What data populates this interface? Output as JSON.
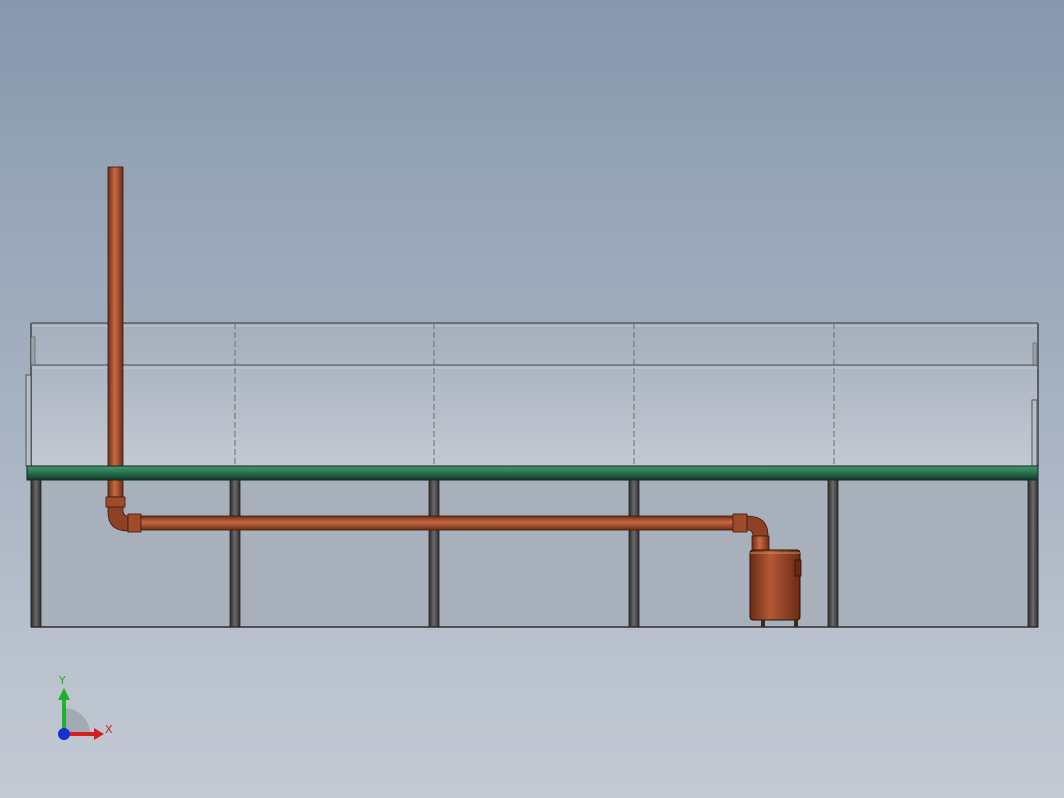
{
  "viewport": {
    "background_top": "#8798ad",
    "background_bottom": "#c3cad4"
  },
  "model": {
    "platform_color": "#2f7a55",
    "pipe_color": "#9b4a2b",
    "frame_color": "#4a4a4a",
    "railing_color": "#8a8e94",
    "tank_color": "#8d3f22"
  },
  "triad": {
    "x_label": "X",
    "y_label": "Y",
    "x_color": "#d42020",
    "y_color": "#20b030",
    "z_color": "#1a2fcf"
  }
}
